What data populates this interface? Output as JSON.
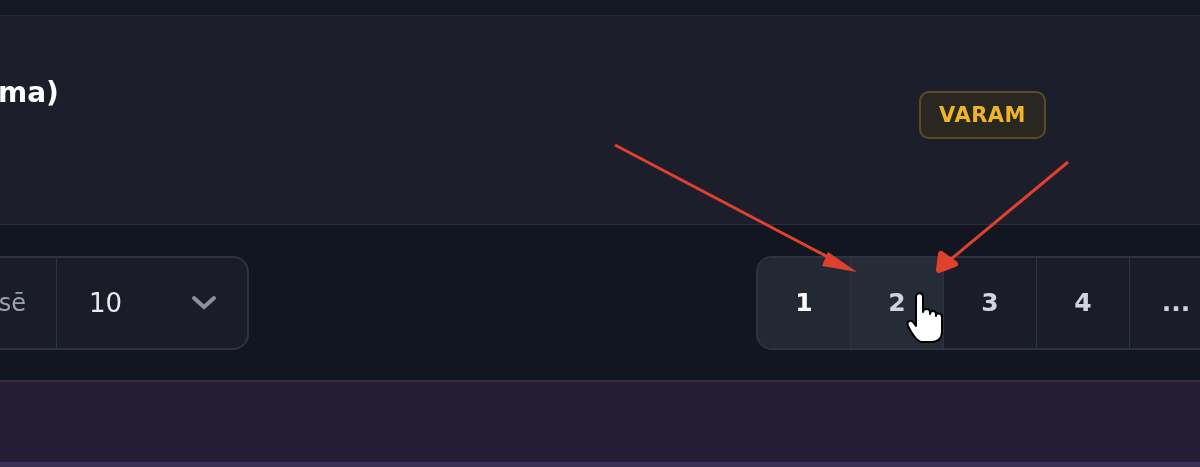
{
  "card": {
    "title": "ma)",
    "badge": "VARAM"
  },
  "page_size": {
    "label": "sē",
    "value": "10"
  },
  "pagination": [
    {
      "label": "1",
      "selected": true,
      "hovered": false
    },
    {
      "label": "2",
      "selected": false,
      "hovered": true
    },
    {
      "label": "3",
      "selected": false,
      "hovered": false
    },
    {
      "label": "4",
      "selected": false,
      "hovered": false
    },
    {
      "label": "...",
      "selected": false,
      "hovered": false
    }
  ]
}
